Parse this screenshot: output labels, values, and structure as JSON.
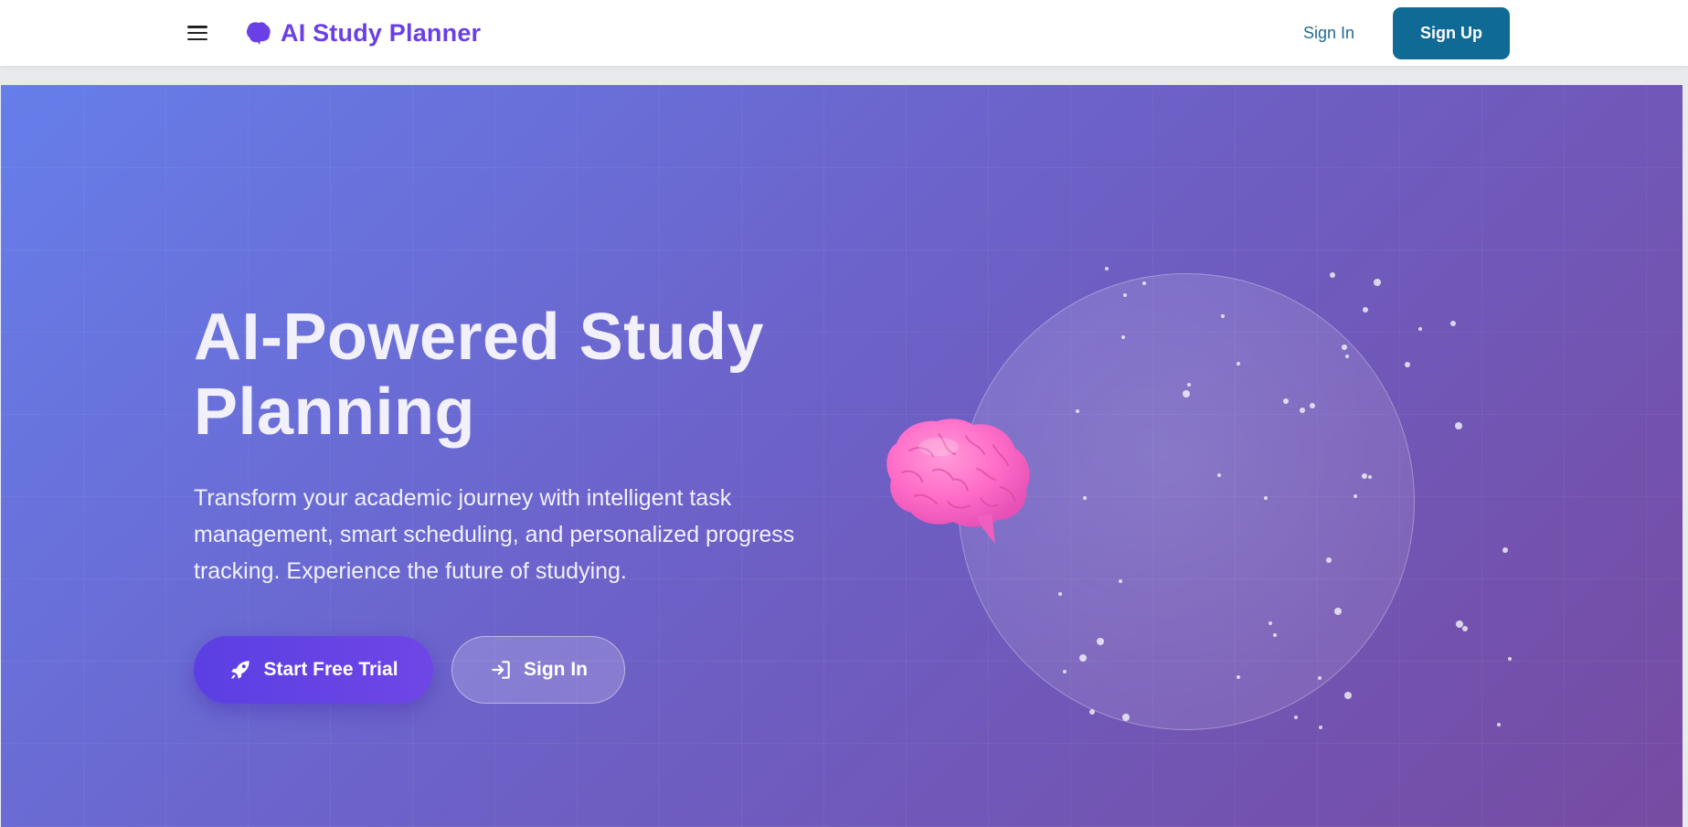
{
  "header": {
    "brand_name": "AI Study Planner",
    "brand_icon": "brain-icon",
    "menu_icon": "hamburger-menu-icon",
    "sign_in_label": "Sign In",
    "sign_up_label": "Sign Up"
  },
  "hero": {
    "title_line1": "AI-Powered Study",
    "title_line2": "Planning",
    "subtitle": "Transform your academic journey with intelligent task management, smart scheduling, and personalized progress tracking. Experience the future of studying.",
    "primary_button_label": "Start Free Trial",
    "primary_button_icon": "rocket-icon",
    "secondary_button_label": "Sign In",
    "secondary_button_icon": "sign-in-icon",
    "illustration": "brain-illustration"
  },
  "colors": {
    "brand": "#6b3fe6",
    "signup_button": "#0f6a96",
    "signin_link": "#1f6b8f",
    "hero_gradient_start": "#667eea",
    "hero_gradient_end": "#764ba2",
    "primary_button": "#5b3fe3",
    "brain": "#ff5fc8"
  }
}
